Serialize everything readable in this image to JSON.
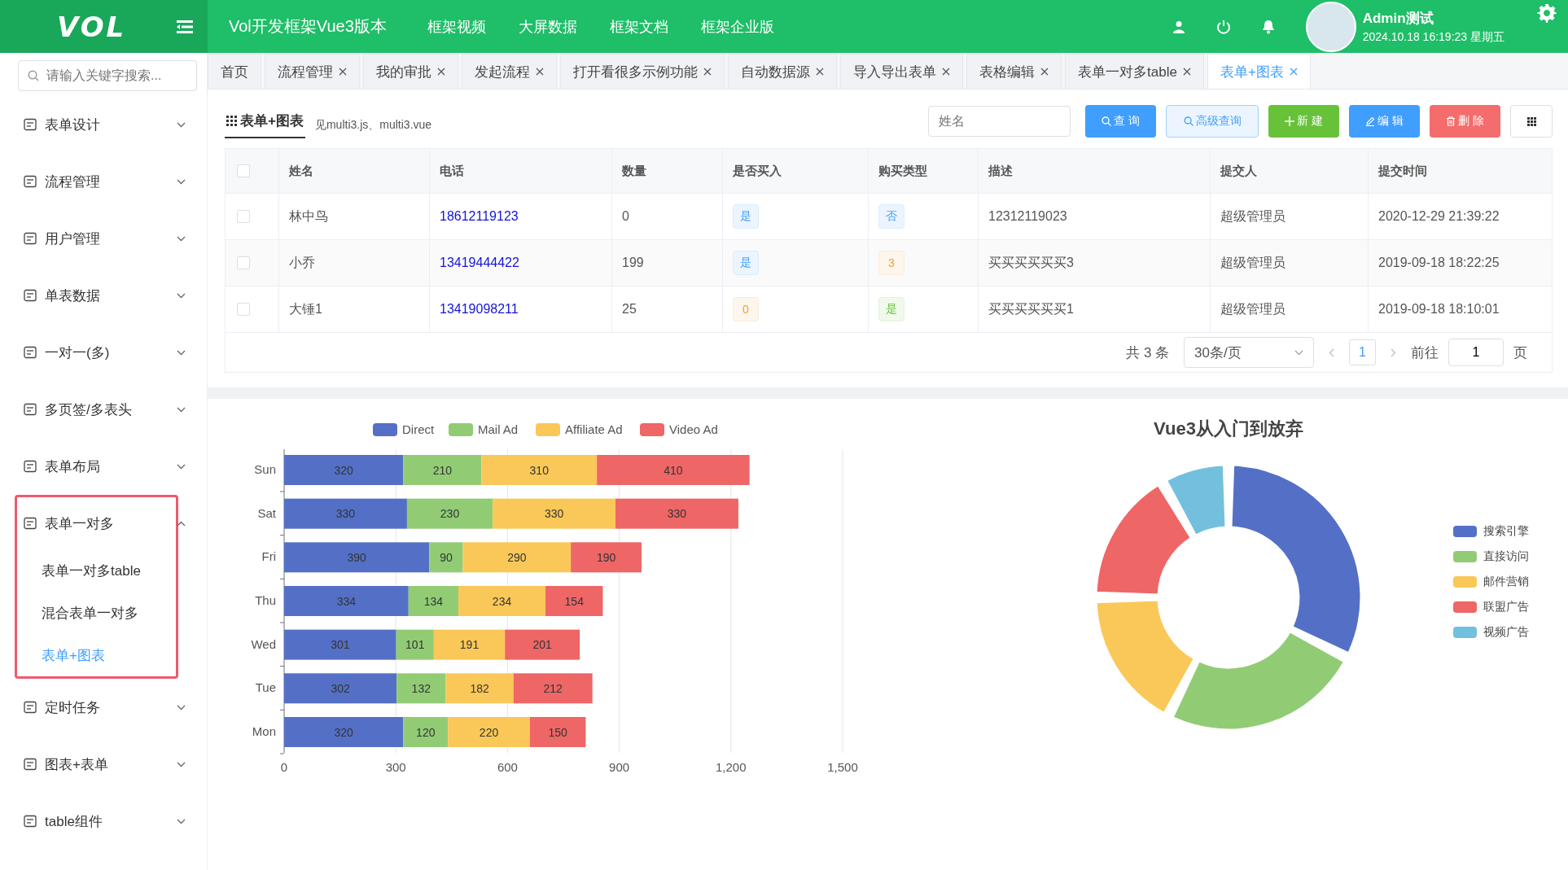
{
  "header": {
    "logo": "VOL",
    "title": "Vol开发框架Vue3版本",
    "links": [
      "框架视频",
      "大屏数据",
      "框架文档",
      "框架企业版"
    ],
    "user": {
      "name": "Admin测试",
      "datetime": "2024.10.18 16:19:23 星期五"
    }
  },
  "sidebar": {
    "search": {
      "placeholder": "请输入关键字搜索..."
    },
    "items": [
      {
        "label": "表单设计",
        "expanded": false,
        "highlighted": false
      },
      {
        "label": "流程管理",
        "expanded": false,
        "highlighted": false
      },
      {
        "label": "用户管理",
        "expanded": false,
        "highlighted": false
      },
      {
        "label": "单表数据",
        "expanded": false,
        "highlighted": false
      },
      {
        "label": "一对一(多)",
        "expanded": false,
        "highlighted": false
      },
      {
        "label": "多页签/多表头",
        "expanded": false,
        "highlighted": false
      },
      {
        "label": "表单布局",
        "expanded": false,
        "highlighted": false
      },
      {
        "label": "表单一对多",
        "expanded": true,
        "highlighted": true,
        "children": [
          {
            "label": "表单一对多table",
            "selected": false
          },
          {
            "label": "混合表单一对多",
            "selected": false
          },
          {
            "label": "表单+图表",
            "selected": true
          }
        ]
      },
      {
        "label": "定时任务",
        "expanded": false,
        "highlighted": false
      },
      {
        "label": "图表+表单",
        "expanded": false,
        "highlighted": false
      },
      {
        "label": "table组件",
        "expanded": false,
        "highlighted": false
      }
    ]
  },
  "tabs": [
    {
      "label": "首页",
      "closable": false,
      "selected": false
    },
    {
      "label": "流程管理",
      "closable": true,
      "selected": false
    },
    {
      "label": "我的审批",
      "closable": true,
      "selected": false
    },
    {
      "label": "发起流程",
      "closable": true,
      "selected": false
    },
    {
      "label": "打开看很多示例功能",
      "closable": true,
      "selected": false
    },
    {
      "label": "自动数据源",
      "closable": true,
      "selected": false
    },
    {
      "label": "导入导出表单",
      "closable": true,
      "selected": false
    },
    {
      "label": "表格编辑",
      "closable": true,
      "selected": false
    },
    {
      "label": "表单一对多table",
      "closable": true,
      "selected": false
    },
    {
      "label": "表单+图表",
      "closable": true,
      "selected": true
    }
  ],
  "toolbar": {
    "title": "表单+图表",
    "subtitle": "见multi3.js、multi3.vue",
    "search": {
      "placeholder": "姓名"
    },
    "buttons": [
      {
        "label": "查 询",
        "kind": "query"
      },
      {
        "label": "高级查询",
        "kind": "advanced"
      },
      {
        "label": "新 建",
        "kind": "create"
      },
      {
        "label": "编 辑",
        "kind": "edit"
      },
      {
        "label": "删 除",
        "kind": "delete"
      }
    ]
  },
  "table": {
    "all_checked": false,
    "columns": [
      "姓名",
      "电话",
      "数量",
      "是否买入",
      "购买类型",
      "描述",
      "提交人",
      "提交时间"
    ],
    "rows": [
      {
        "checked": false,
        "name": "林中鸟",
        "phone": "18612119123",
        "qty": "0",
        "bought": {
          "text": "是",
          "kind": "info"
        },
        "buy_type": {
          "text": "否",
          "kind": "info"
        },
        "desc": "12312119023",
        "submitter": "超级管理员",
        "time": "2020-12-29 21:39:22"
      },
      {
        "checked": false,
        "name": "小乔",
        "phone": "13419444422",
        "qty": "199",
        "bought": {
          "text": "是",
          "kind": "info"
        },
        "buy_type": {
          "text": "3",
          "kind": "warning"
        },
        "desc": "买买买买买买3",
        "submitter": "超级管理员",
        "time": "2019-09-18 18:22:25"
      },
      {
        "checked": false,
        "name": "大锤1",
        "phone": "13419098211",
        "qty": "25",
        "bought": {
          "text": "0",
          "kind": "warning"
        },
        "buy_type": {
          "text": "是",
          "kind": "success"
        },
        "desc": "买买买买买买1",
        "submitter": "超级管理员",
        "time": "2019-09-18 18:10:01"
      }
    ]
  },
  "pagination": {
    "total": "共 3 条",
    "page_size": "30条/页",
    "pages": [
      {
        "label": "1",
        "selected": true
      }
    ],
    "goto_label": "前往",
    "goto_value": "1",
    "goto_suffix": "页"
  },
  "bar_chart": {
    "chart_data": {
      "type": "bar",
      "orientation": "horizontal",
      "stacked": true,
      "data_labels": true,
      "grid": true,
      "legend": "top",
      "categories": [
        "Sun",
        "Sat",
        "Fri",
        "Thu",
        "Wed",
        "Tue",
        "Mon"
      ],
      "series": [
        {
          "name": "Direct",
          "color": "#5470c6",
          "values": [
            320,
            330,
            390,
            334,
            301,
            302,
            320
          ]
        },
        {
          "name": "Mail Ad",
          "color": "#91cc75",
          "values": [
            210,
            230,
            90,
            134,
            101,
            132,
            120
          ]
        },
        {
          "name": "Affiliate Ad",
          "color": "#fac858",
          "values": [
            310,
            330,
            290,
            234,
            191,
            182,
            220
          ]
        },
        {
          "name": "Video Ad",
          "color": "#ee6666",
          "values": [
            410,
            330,
            190,
            154,
            201,
            212,
            150
          ]
        }
      ],
      "xlim": [
        0,
        1500
      ],
      "xticks": [
        0,
        300,
        600,
        900,
        {
          "value": 1200,
          "label": "1,200"
        },
        {
          "value": 1500,
          "label": "1,500"
        }
      ]
    }
  },
  "donut": {
    "title": "Vue3从入门到放弃",
    "legend": [
      {
        "label": "搜索引擎",
        "color": "#5470c6"
      },
      {
        "label": "直接访问",
        "color": "#91cc75"
      },
      {
        "label": "邮件营销",
        "color": "#fac858"
      },
      {
        "label": "联盟广告",
        "color": "#ee6666"
      },
      {
        "label": "视频广告",
        "color": "#73c0de"
      }
    ]
  }
}
